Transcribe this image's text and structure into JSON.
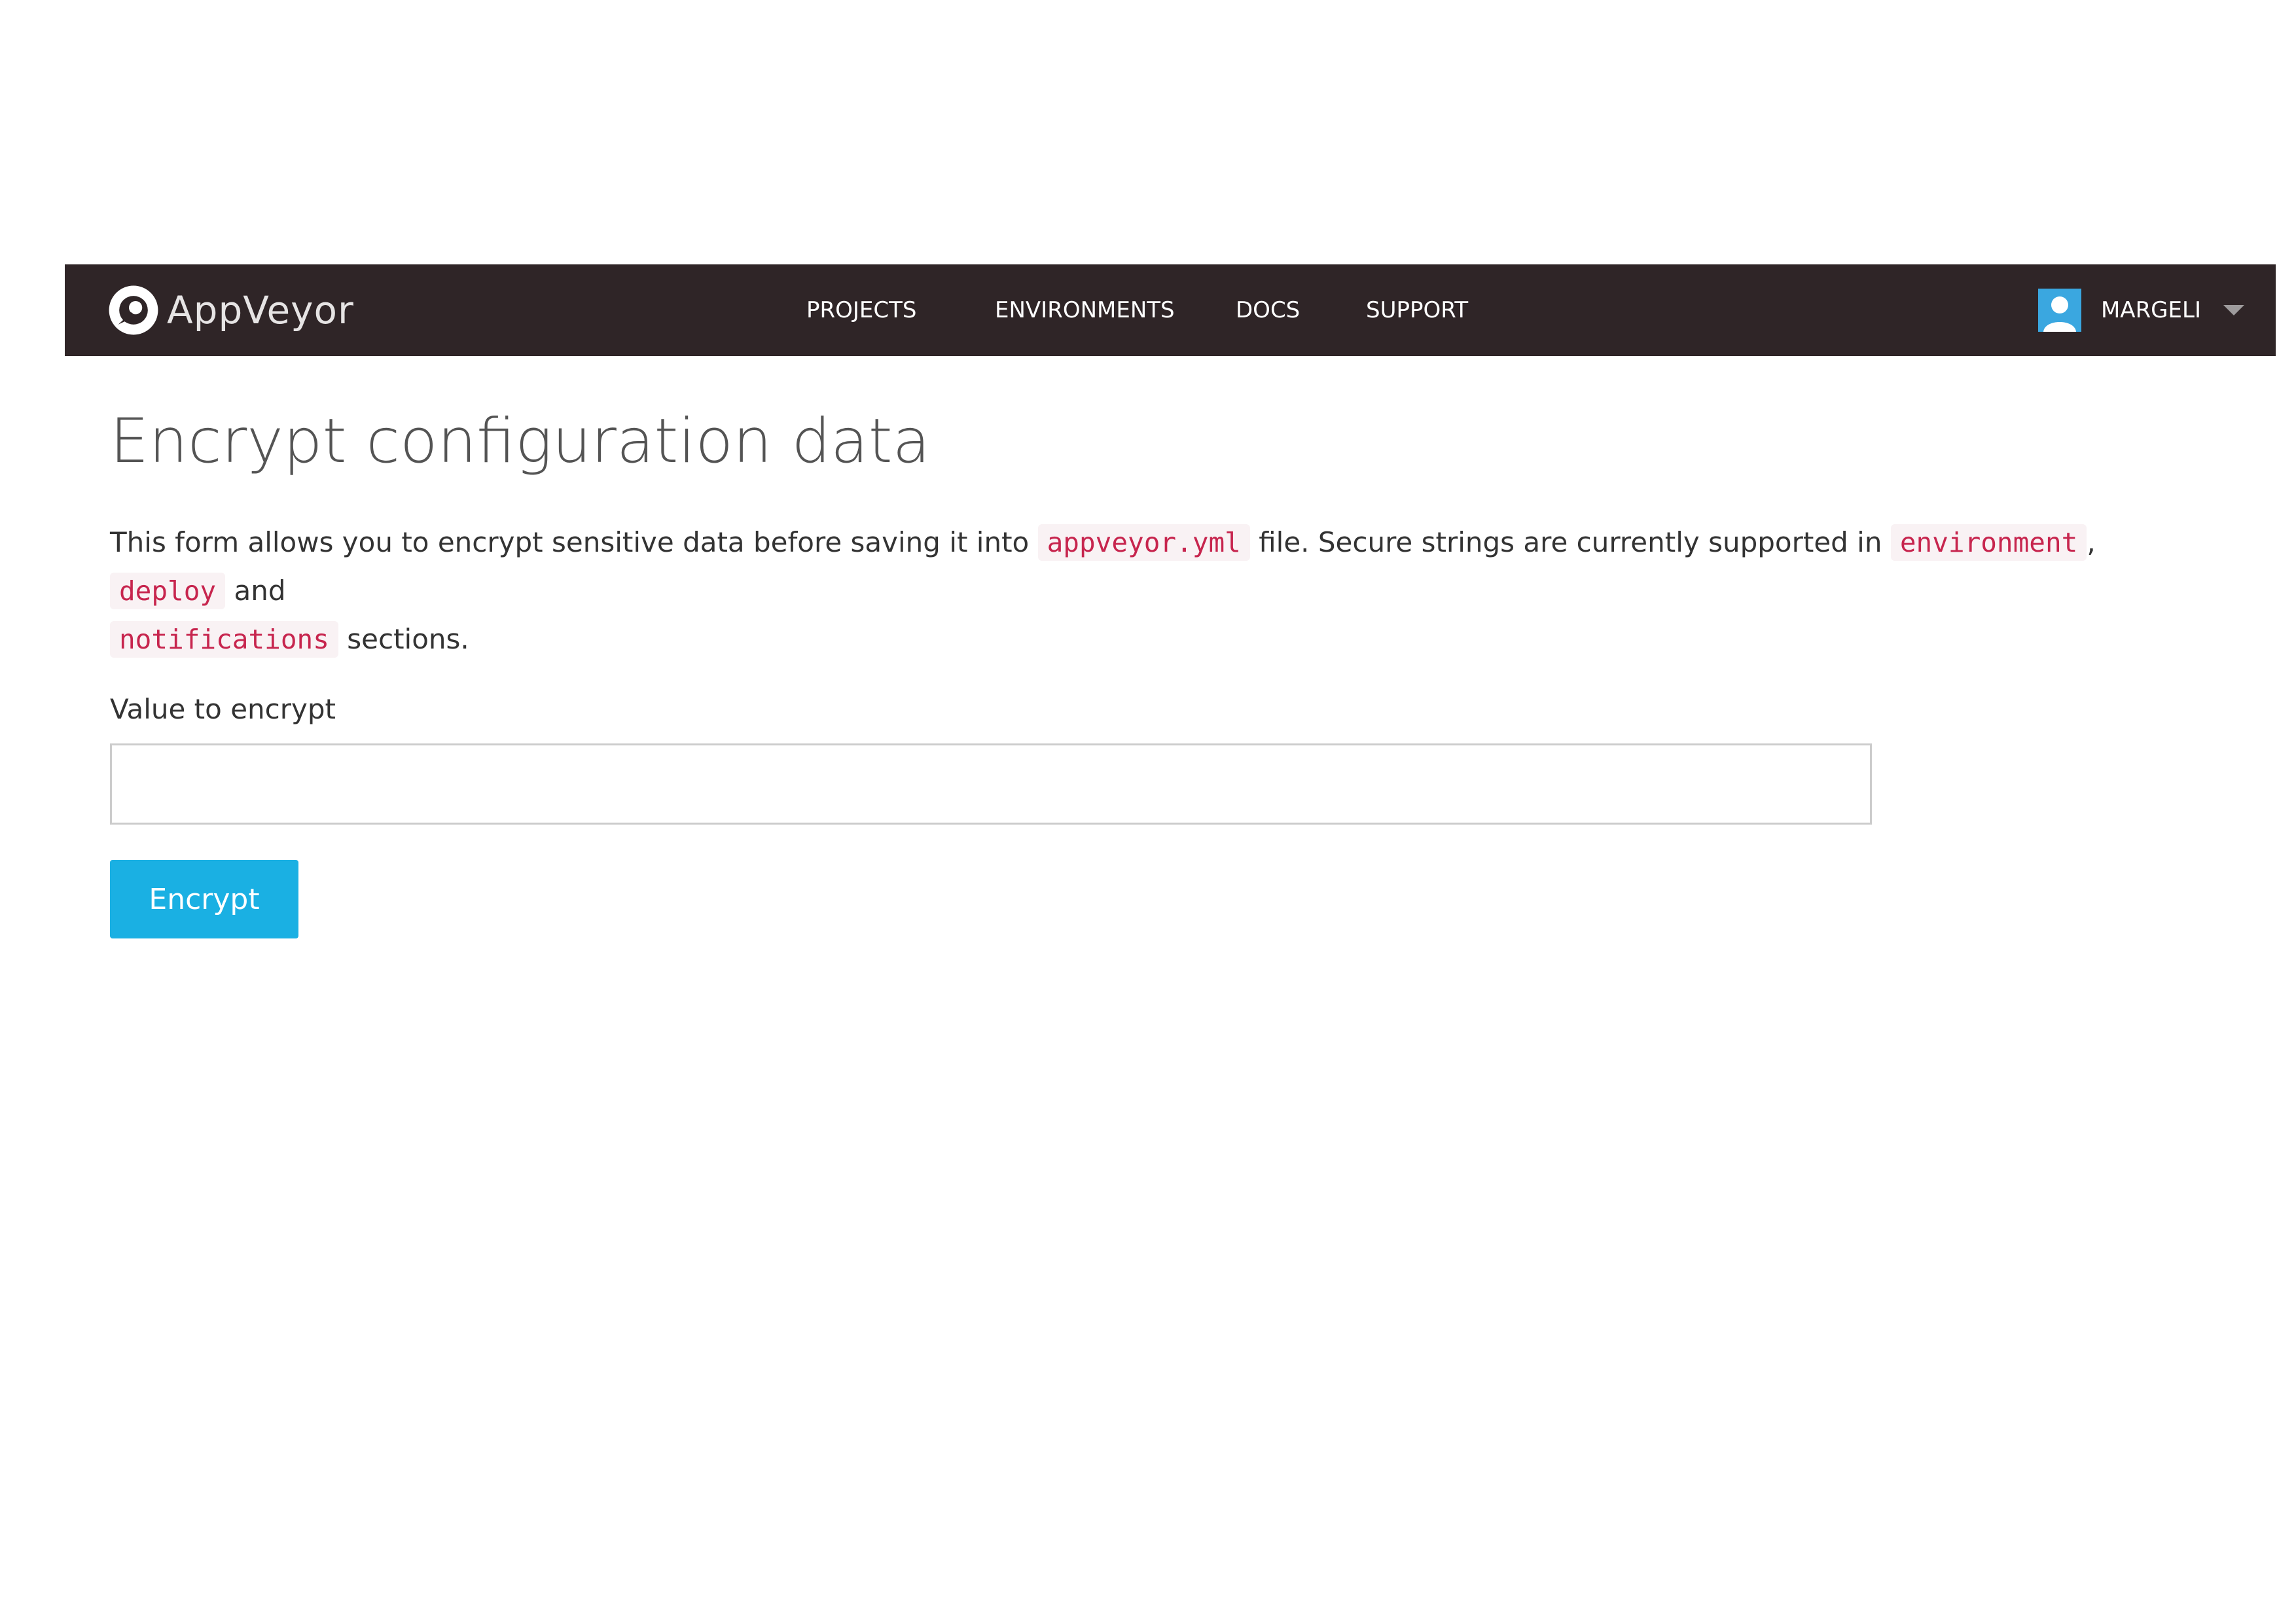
{
  "header": {
    "brand": {
      "name": "AppVeyor",
      "logo_icon": "appveyor-logo-icon"
    },
    "nav": [
      {
        "label": "PROJECTS"
      },
      {
        "label": "ENVIRONMENTS"
      },
      {
        "label": "DOCS"
      },
      {
        "label": "SUPPORT"
      }
    ],
    "user": {
      "name": "MARGELI",
      "avatar_icon": "user-avatar-icon",
      "menu_icon": "caret-down-icon"
    }
  },
  "main": {
    "title": "Encrypt configuration data",
    "description": {
      "text_1": "This form allows you to encrypt sensitive data before saving it into",
      "code_file": "appveyor.yml",
      "text_2": "file. Secure strings are currently supported in",
      "code_environment": "environment",
      "sep_comma": ",",
      "code_deploy": "deploy",
      "text_and": "and",
      "code_notifications": "notifications",
      "text_end": "sections."
    },
    "form": {
      "label": "Value to encrypt",
      "value": "",
      "placeholder": "",
      "button_label": "Encrypt"
    }
  },
  "colors": {
    "navbar_bg": "#2f2527",
    "button_bg": "#1ab0e3",
    "code_text": "#c7254e",
    "code_bg": "#f9f2f4",
    "avatar_bg": "#3aa7e0"
  }
}
